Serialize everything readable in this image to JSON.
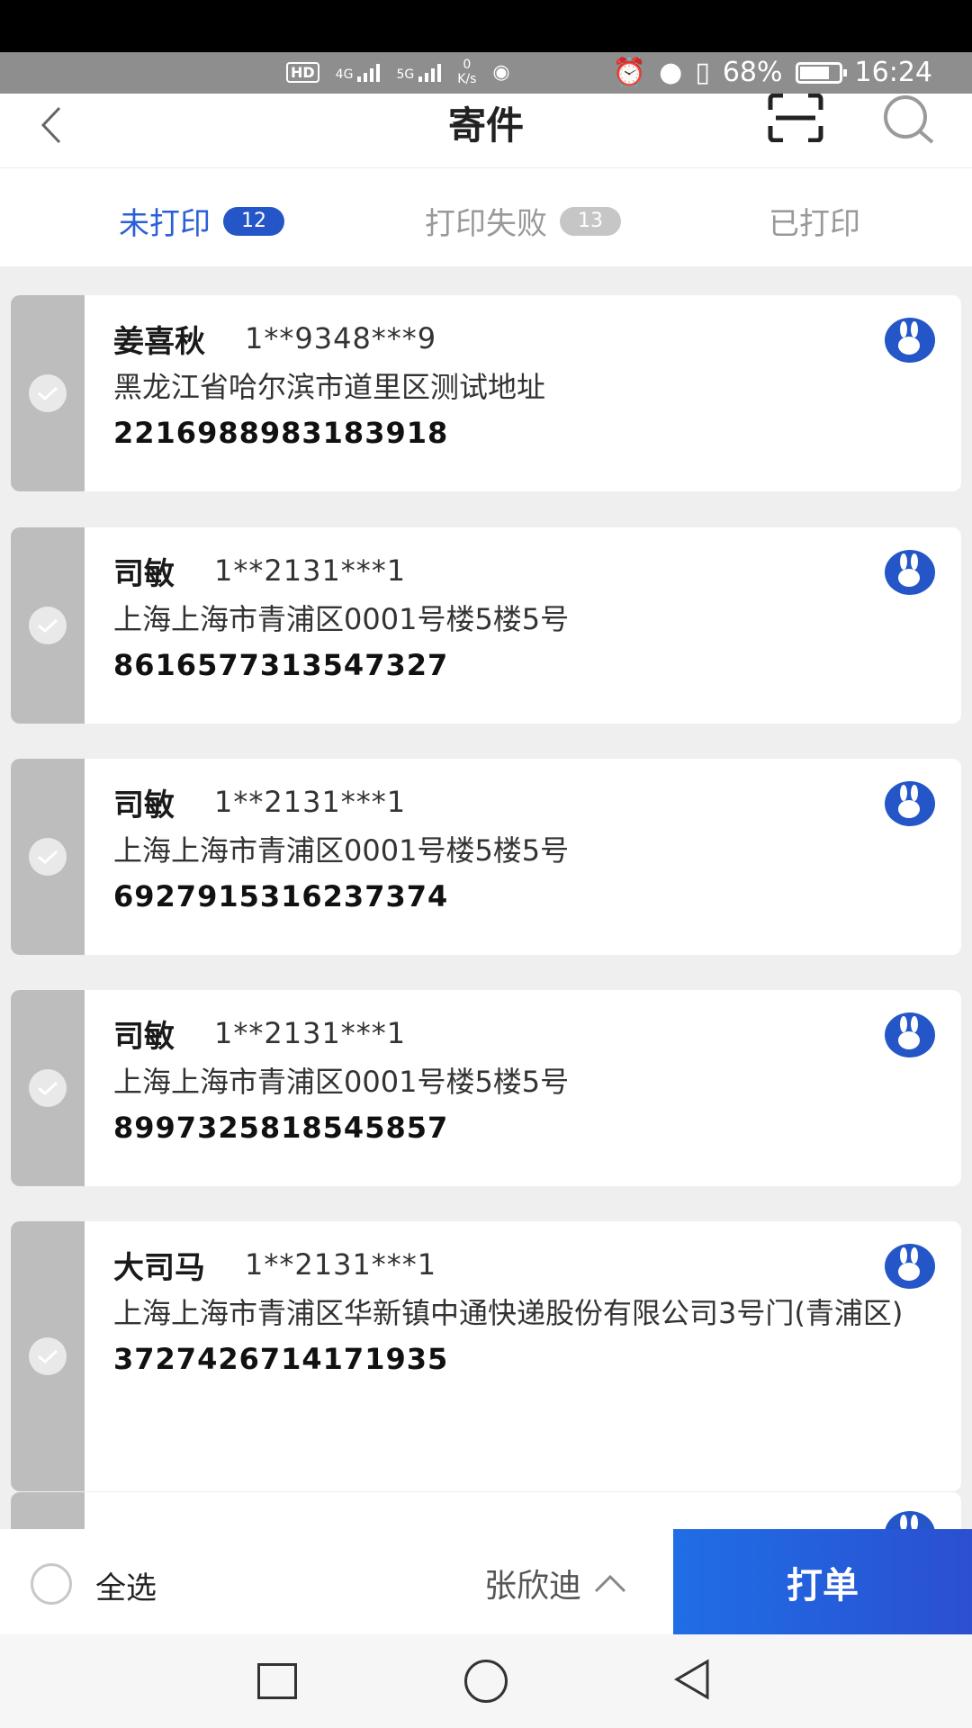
{
  "status_bar": {
    "hd": "HD",
    "network1": "4G",
    "network2": "5G",
    "speed_value": "0",
    "speed_unit": "K/s",
    "battery": "68%",
    "time": "16:24"
  },
  "header": {
    "title": "寄件"
  },
  "tabs": [
    {
      "label": "未打印",
      "count": "12",
      "active": true
    },
    {
      "label": "打印失败",
      "count": "13",
      "active": false
    },
    {
      "label": "已打印",
      "count": "",
      "active": false
    }
  ],
  "orders": [
    {
      "name": "姜喜秋",
      "phone": "1**9348***9",
      "address": "黑龙江省哈尔滨市道里区测试地址",
      "waybill": "2216988983183918"
    },
    {
      "name": "司敏",
      "phone": "1**2131***1",
      "address": "上海上海市青浦区0001号楼5楼5号",
      "waybill": "8616577313547327"
    },
    {
      "name": "司敏",
      "phone": "1**2131***1",
      "address": "上海上海市青浦区0001号楼5楼5号",
      "waybill": "6927915316237374"
    },
    {
      "name": "司敏",
      "phone": "1**2131***1",
      "address": "上海上海市青浦区0001号楼5楼5号",
      "waybill": "8997325818545857"
    },
    {
      "name": "大司马",
      "phone": "1**2131***1",
      "address": "上海上海市青浦区华新镇中通快递股份有限公司3号门(青浦区)",
      "waybill": "3727426714171935"
    }
  ],
  "bottom_bar": {
    "select_all": "全选",
    "operator": "张欣迪",
    "print_label": "打单"
  },
  "colors": {
    "accent": "#2556c7",
    "print_button": "#1f6ee6"
  }
}
